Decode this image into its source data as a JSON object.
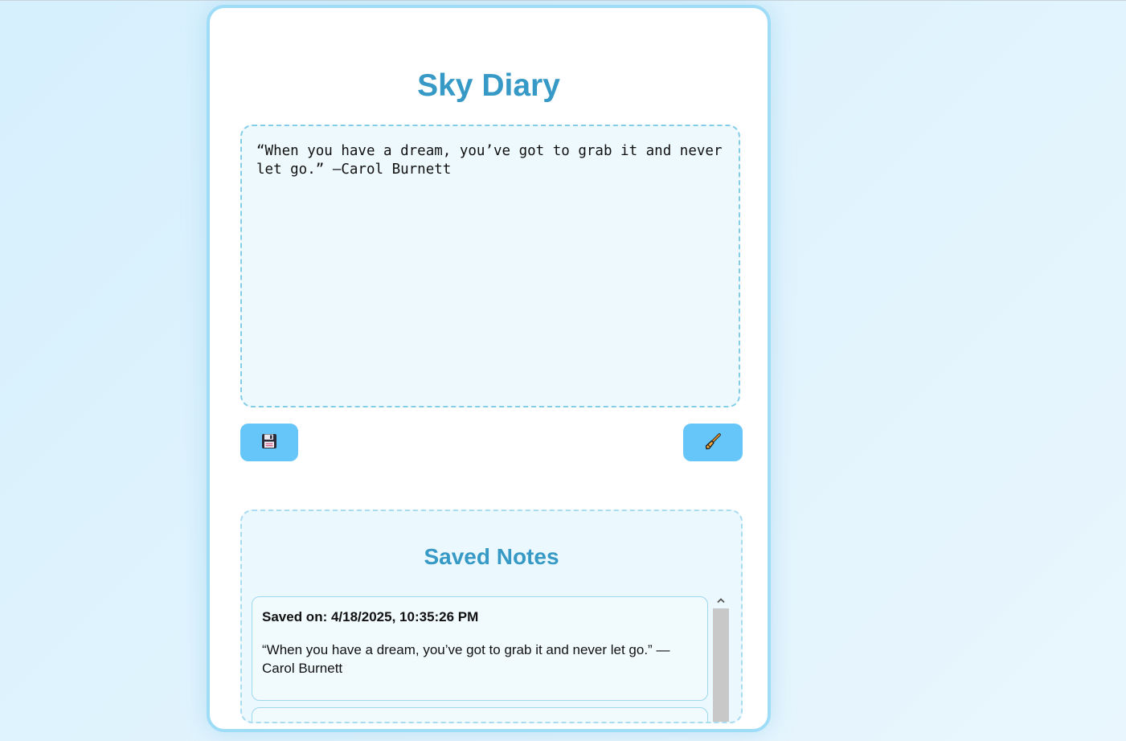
{
  "app": {
    "title": "Sky Diary"
  },
  "editor": {
    "value": "“When you have a dream, you’ve got to grab it and never let go.” —Carol Burnett"
  },
  "toolbar": {
    "save_icon": "floppy-disk-icon",
    "clear_icon": "broom-icon"
  },
  "saved": {
    "title": "Saved Notes",
    "notes": [
      {
        "date": "Saved on: 4/18/2025, 10:35:26 PM",
        "text": "“When you have a dream, you’ve got to grab it and never let go.” —Carol Burnett"
      }
    ]
  },
  "colors": {
    "accent": "#3699c6",
    "button": "#66c5f9",
    "border": "#9edcf7"
  }
}
